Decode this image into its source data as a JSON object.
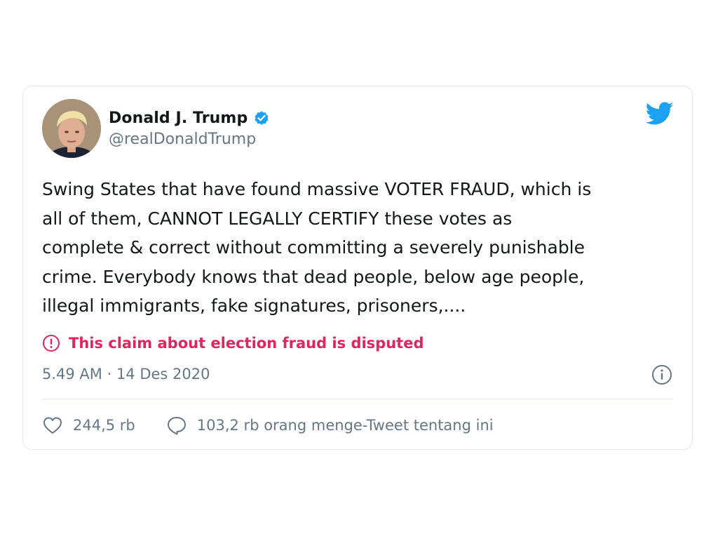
{
  "tweet": {
    "author": {
      "display_name": "Donald J. Trump",
      "handle": "@realDonaldTrump",
      "verified": true,
      "avatar_icon": "profile-photo"
    },
    "text": "Swing States that have found massive VOTER FRAUD, which is\nall of them, CANNOT LEGALLY CERTIFY these votes as\ncomplete & correct without committing a severely punishable\ncrime. Everybody knows that dead people, below age people,\nillegal immigrants, fake signatures, prisoners,....",
    "notice": {
      "icon": "exclamation-circle-icon",
      "text": "This claim about election fraud is disputed"
    },
    "timestamp": "5.49 AM · 14 Des 2020",
    "likes": {
      "icon": "heart-icon",
      "count": "244,5 rb"
    },
    "conversation": {
      "icon": "speech-bubble-icon",
      "text": "103,2 rb orang menge-Tweet tentang ini"
    }
  },
  "colors": {
    "brand_blue": "#1da1f2",
    "warning_red": "#e0245e",
    "text_primary": "#14171a",
    "text_secondary": "#657786",
    "border": "#e1e8ed"
  }
}
